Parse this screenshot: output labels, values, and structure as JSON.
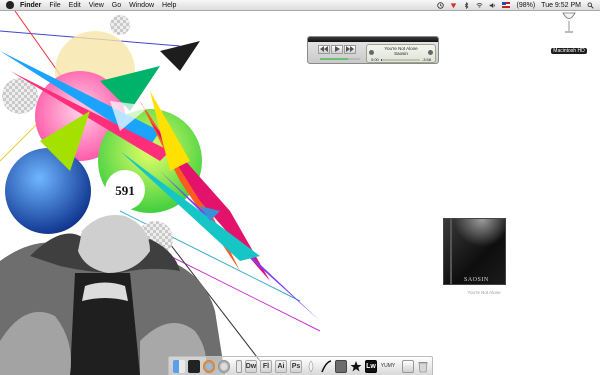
{
  "menubar": {
    "app_name": "Finder",
    "items": [
      "File",
      "Edit",
      "View",
      "Go",
      "Window",
      "Help"
    ],
    "battery": "(98%)",
    "clock": "Tue 9:52 PM",
    "status_icons": [
      "time-machine-icon",
      "extra-icon",
      "bluetooth-icon",
      "wifi-icon",
      "volume-icon",
      "us-flag-icon",
      "battery-icon"
    ]
  },
  "artwork": {
    "logo_text": "591"
  },
  "itunes_widget": {
    "track": "You're Not Alone",
    "artist": "Saosin",
    "elapsed": "0:00",
    "remaining": "-3:58",
    "progress": 0.01,
    "volume": 0.7,
    "controls": [
      "previous-icon",
      "play-icon",
      "next-icon"
    ]
  },
  "desktop": {
    "hard_drive_label": "Macintosh HD",
    "album": {
      "band_name": "SAOSIN",
      "caption": "You're Not Alone"
    }
  },
  "dock": {
    "items": [
      {
        "name": "finder-icon",
        "label": ""
      },
      {
        "name": "terminal-icon",
        "label": ""
      },
      {
        "name": "firefox-icon",
        "label": ""
      },
      {
        "name": "settings-icon",
        "label": ""
      },
      {
        "name": "ipod-icon",
        "label": ""
      },
      {
        "name": "dreamweaver-icon",
        "label": "Dw"
      },
      {
        "name": "flash-icon",
        "label": "Fl"
      },
      {
        "name": "illustrator-icon",
        "label": "Ai"
      },
      {
        "name": "photoshop-icon",
        "label": "Ps"
      },
      {
        "name": "feather-icon",
        "label": ""
      },
      {
        "name": "adium-icon",
        "label": ""
      },
      {
        "name": "itunes-icon",
        "label": ""
      },
      {
        "name": "star-icon",
        "label": ""
      },
      {
        "name": "lightwave-icon",
        "label": "Lw"
      },
      {
        "name": "yumi-icon",
        "label": "YUMY"
      },
      {
        "name": "stacks-icon",
        "label": ""
      },
      {
        "name": "trash-icon",
        "label": ""
      }
    ]
  }
}
